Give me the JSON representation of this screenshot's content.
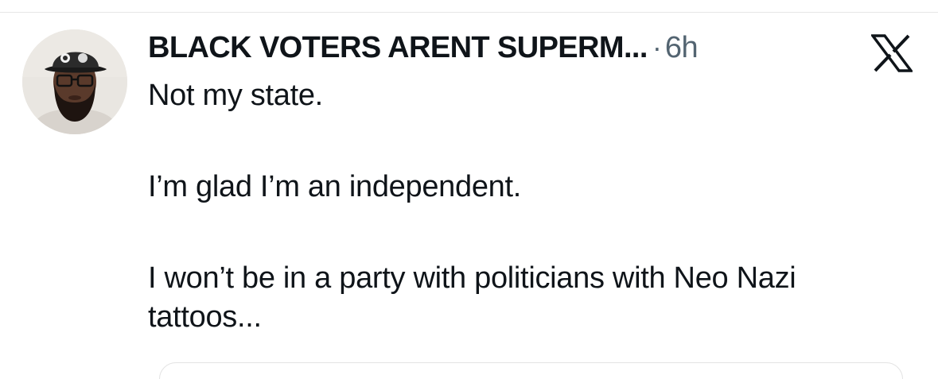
{
  "tweet": {
    "display_name": "BLACK VOTERS ARENT SUPERM...",
    "separator": "·",
    "time": "6h",
    "paragraphs": [
      "Not my state.",
      "I’m glad I’m an independent.",
      "I won’t be in a party with politicians with Neo Nazi tattoos..."
    ]
  },
  "icons": {
    "platform_logo": "x-logo-icon",
    "avatar": "profile-avatar-photo"
  },
  "colors": {
    "text_primary": "#0f1419",
    "text_secondary": "#536471",
    "background": "#ffffff",
    "divider": "#e6e6e6"
  }
}
